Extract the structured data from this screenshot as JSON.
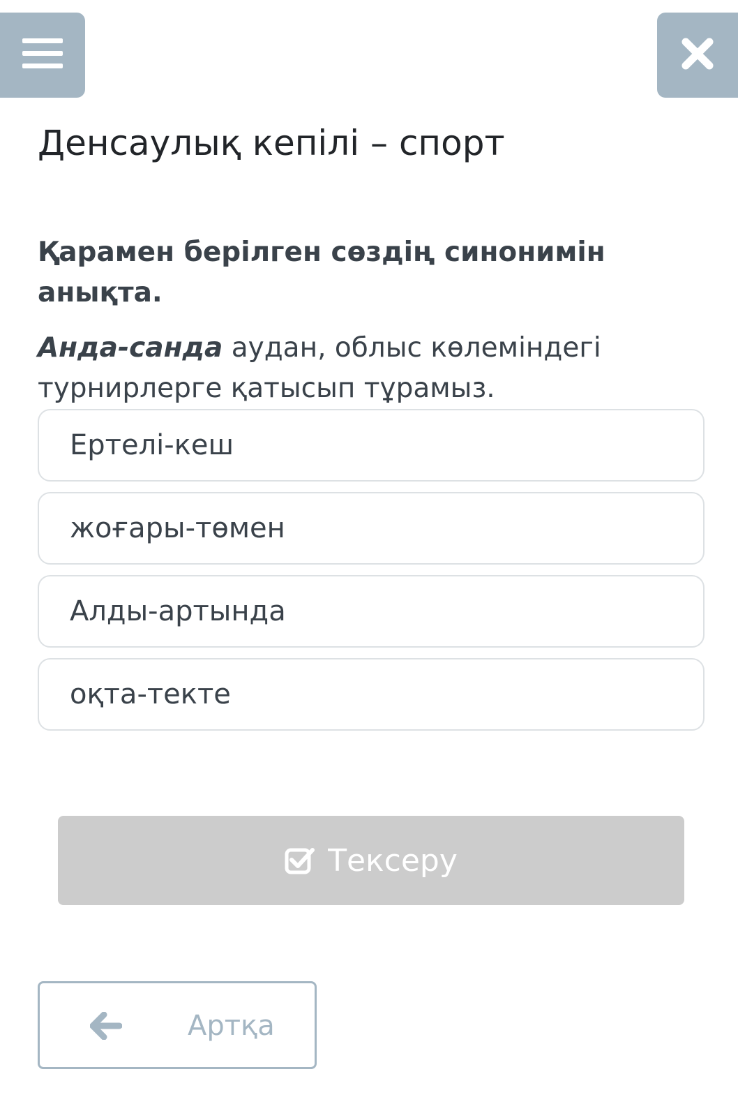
{
  "header": {
    "menu_icon": "hamburger-menu-icon",
    "close_icon": "close-icon"
  },
  "page": {
    "title": "Денсаулық кепілі – спорт"
  },
  "question": {
    "instruction": "Қарамен берілген сөздің синонимін анықта.",
    "highlighted_word": "Анда-санда",
    "sentence_rest": " аудан, облыс көлеміндегі турнирлерге қатысып тұрамыз."
  },
  "options": [
    {
      "label": "Ертелі-кеш"
    },
    {
      "label": "жоғары-төмен"
    },
    {
      "label": "Алды-артында"
    },
    {
      "label": "оқта-текте"
    }
  ],
  "actions": {
    "check_label": "Тексеру",
    "check_icon": "check-square-icon",
    "back_label": "Артқа",
    "back_icon": "arrow-left-icon"
  },
  "colors": {
    "accent": "#a4b6c3",
    "disabled_button": "#cccccc",
    "text": "#3a424a"
  }
}
